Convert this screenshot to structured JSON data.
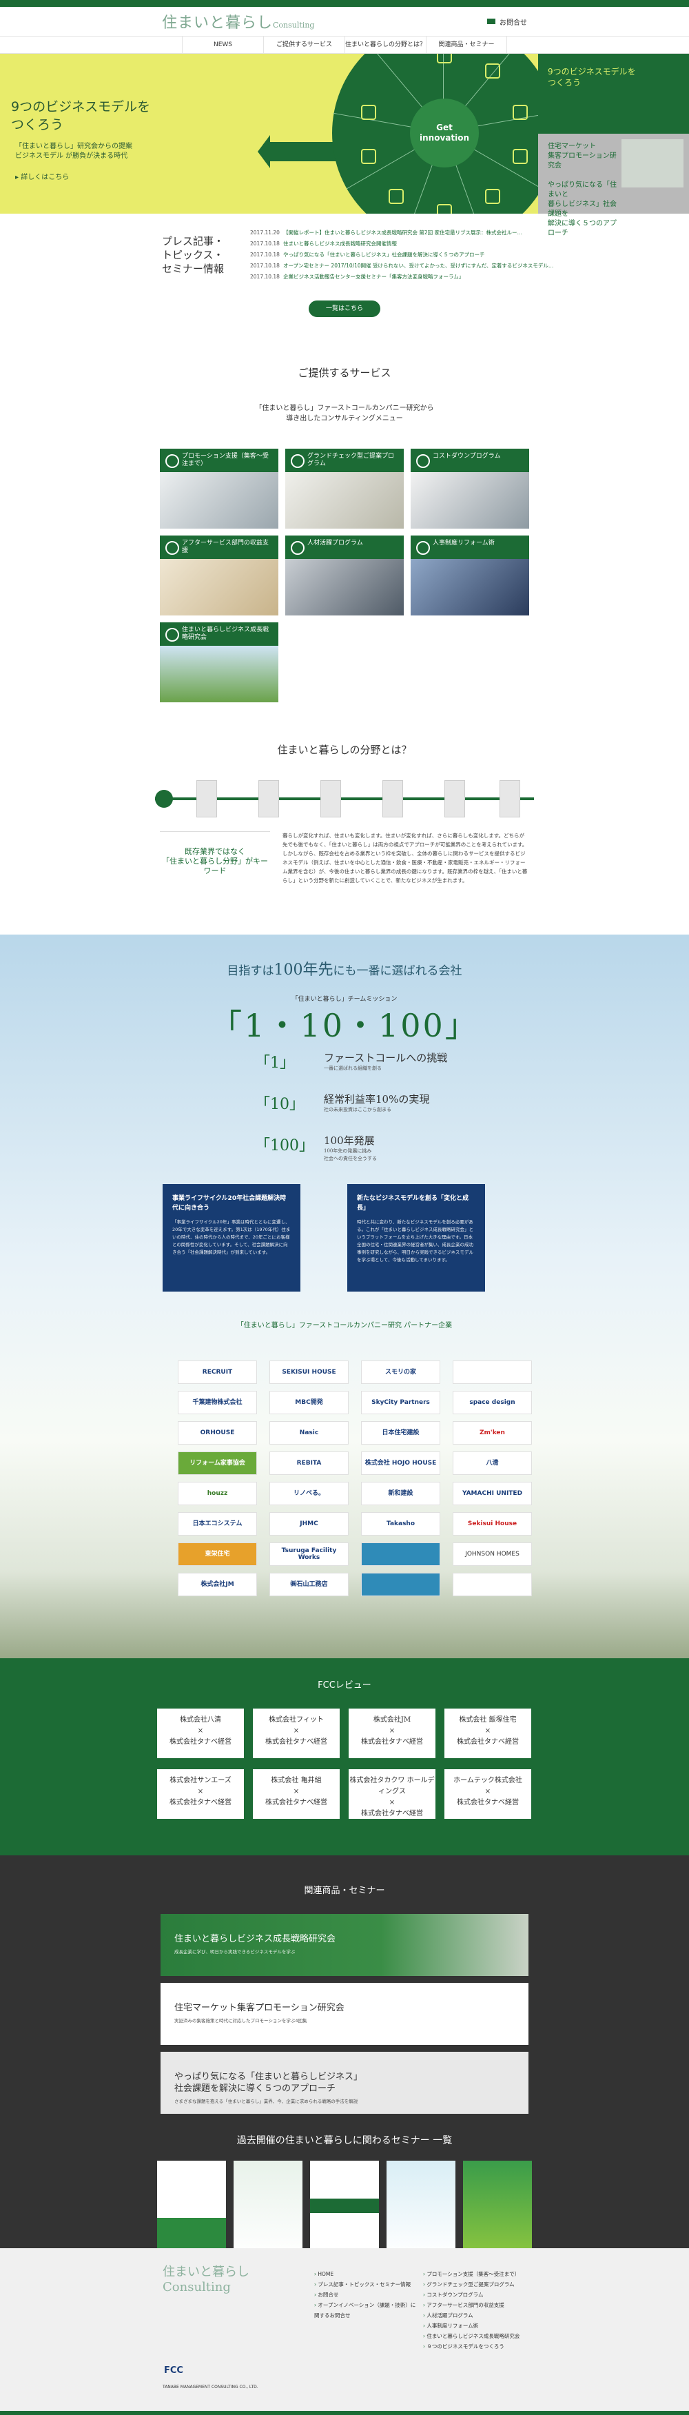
{
  "header": {
    "logo_main": "住まいと暮らし",
    "logo_sub": "Consulting",
    "contact": "お問合せ"
  },
  "nav": [
    "NEWS",
    "ご提供するサービス",
    "住まいと暮らしの分野とは？",
    "関連商品・セミナー"
  ],
  "hero": {
    "title_line1": "9つのビジネスモデルを",
    "title_line2": "つくろう",
    "sub_line1": "「住まいと暮らし」研究会からの提案",
    "sub_line2": "ビジネスモデル が勝負が決まる時代",
    "more": "詳しくはこちら",
    "center_line1": "Get",
    "center_line2": "innovation",
    "side1_line1": "9つのビジネスモデルを",
    "side1_line2": "つくろう",
    "side2_line1": "住宅マーケット",
    "side2_line2": "集客プロモーション研究会",
    "side2_line3": "やっぱり気になる「住まいと",
    "side2_line4": "暮らしビジネス」社会課題を",
    "side2_line5": "解決に導く５つのアプローチ"
  },
  "news": {
    "title_line1": "プレス記事・",
    "title_line2": "トピックス・",
    "title_line3": "セミナー情報",
    "items": [
      {
        "date": "2017.11.20",
        "text": "【開催レポート】住まいと暮らしビジネス成長戦略研究会 第2回 家住宅最リブス展示：株式会社ルー…"
      },
      {
        "date": "2017.10.18",
        "text": "住まいと暮らしビジネス成長戦略研究会開催情報"
      },
      {
        "date": "2017.10.18",
        "text": "やっぱり気になる「住まいと暮らしビジネス」社会課題を解決に導く５つのアプローチ"
      },
      {
        "date": "2017.10.18",
        "text": "オープン宅セミナー 2017/10/10開催 受けられない、受けてよかった、受けずにすんだ、定着するビジネスモデル…"
      },
      {
        "date": "2017.10.18",
        "text": "企業ビジネス活動報告センター支援セミナー「集客方法変身戦略フォーラム」"
      }
    ],
    "button": "一覧はこちら"
  },
  "services": {
    "title": "ご提供するサービス",
    "lead_line1": "「住まいと暮らし」ファーストコールカンパニー研究から",
    "lead_line2": "導き出したコンサルティングメニュー",
    "items": [
      {
        "label": "プロモーション支援（集客〜受注まで）"
      },
      {
        "label": "グランドチェック型ご提案プログラム"
      },
      {
        "label": "コストダウンプログラム"
      },
      {
        "label": "アフターサービス部門の収益支援"
      },
      {
        "label": "人材活躍プログラム"
      },
      {
        "label": "人事制度リフォーム術"
      },
      {
        "label": "住まいと暮らしビジネス成長戦略研究会"
      }
    ]
  },
  "field": {
    "title": "住まいと暮らしの分野とは？",
    "key_line1": "既存業界ではなく",
    "key_line2": "「住まいと暮らし分野」がキーワード",
    "body": "暮らしが変化すれば、住まいも変化します。住まいが変化すれば、さらに暮らしも変化します。どちらが先でも後でもなく、「住まいと暮らし」は両方の視点でアプローチが可能業界のことを考えられています。しかしながら、既存会社を占める業界という枠を突破し、全体の暮らしに関わるサービスを提供するビジネスモデル（例えば、住まいを中心とした通信・飲食・医療・不動産・家電販売・エネルギー・リフォーム業界を含む）が、今後の住まいと暮らし業界の成長の鍵になります。既存業界の枠を越え、「住まいと暮らし」という分野を新たに創造していくことで、新たなビジネスが生まれます。"
  },
  "mission": {
    "title_a": "目指すは",
    "title_b": "100年先",
    "title_c": "にも一番に選ばれる会社",
    "sub": "「住まいと暮らし」チームミッション",
    "number": "「1・10・100」",
    "rows": [
      {
        "key": "「1」",
        "value": "ファーストコールへの挑戦",
        "note": "一番に選ばれる組織を創る"
      },
      {
        "key": "「10」",
        "value": "経常利益率10%の実現",
        "note": "社の未来投資はここから創まる"
      },
      {
        "key": "「100」",
        "value": "100年発展",
        "note1": "100年先の発展に挑み",
        "note2": "社会への責任を全うする"
      }
    ],
    "box1_title": "事業ライフサイクル20年社会課題解決時代に向き合う",
    "box1_text": "「事業ライフサイクル20年」事業は時代とともに変遷し、20年で大きな変革を迎えます。第1次は（1970年代）住まいの時代、住の時代から人の時代まで、20年ごとにお客様との関係性が変化しています。そして、社会課題解決に向き合う「社会課題解決時代」が到来しています。",
    "box2_title": "新たなビジネスモデルを創る「変化と成長」",
    "box2_text": "時代と共に変わり、新たなビジネスモデルを創る必要がある。これが「住まいと暮らしビジネス成長戦略研究会」というプラットフォームを立ち上げた大きな理由です。日本全国の住宅・住関連業界の経営者が集い、成長企業の成功事例を研究しながら、明日から実践できるビジネスモデルを学ぶ場として、今後も活動してまいります。",
    "partner_title": "「住まいと暮らし」ファーストコールカンパニー研究 パートナー企業",
    "partners": [
      "RECRUIT",
      "SEKISUI HOUSE",
      "スモリの家",
      "",
      "千葉建物株式会社",
      "MBC開発",
      "SkyCity Partners",
      "space design",
      "ORHOUSE",
      "Nasic",
      "日本住宅建設",
      "Zm'ken",
      "リフォーム家事協会",
      "REBITA",
      "株式会社 HOJO HOUSE",
      "八清",
      "houzz",
      "リノベる。",
      "新和建設",
      "YAMACHI UNITED",
      "日本エコシステム",
      "JHMC",
      "Takasho",
      "Sekisui House",
      "東栄住宅",
      "Tsuruga Facility Works",
      "",
      "JOHNSON HOMES",
      "株式会社JM",
      "㈱石山工務店",
      "",
      ""
    ]
  },
  "fcc": {
    "title": "FCCレビュー",
    "cards": [
      {
        "a": "株式会社八清",
        "b": "×",
        "c": "株式会社タナベ経営"
      },
      {
        "a": "株式会社フィット",
        "b": "×",
        "c": "株式会社タナベ経営"
      },
      {
        "a": "株式会社JM",
        "b": "×",
        "c": "株式会社タナベ経営"
      },
      {
        "a": "株式会社 飯塚住宅",
        "b": "×",
        "c": "株式会社タナベ経営"
      },
      {
        "a": "株式会社サンエーズ",
        "b": "×",
        "c": "株式会社タナベ経営"
      },
      {
        "a": "株式会社 亀井組",
        "b": "×",
        "c": "株式会社タナベ経営"
      },
      {
        "a": "株式会社タカクワ ホールディングス",
        "b": "×",
        "c": "株式会社タナベ経営"
      },
      {
        "a": "ホームテック株式会社",
        "b": "×",
        "c": "株式会社タナベ経営"
      }
    ]
  },
  "related": {
    "title": "関連商品・セミナー",
    "b1_title": "住まいと暮らしビジネス成長戦略研究会",
    "b1_sub": "成長企業に学び、明日から実践できるビジネスモデルを学ぶ",
    "b2_title": "住宅マーケット集客プロモーション研究会",
    "b2_sub": "実証済みの集客施策と時代に対応したプロモーションを学ぶ4回集",
    "b3_title_line1": "やっぱり気になる「住まいと暮らしビジネス」",
    "b3_title_line2": "社会課題を解決に導く５つのアプローチ",
    "b3_sub": "さまざまな課題を抱える「住まいと暮らし」業界、今、企業に求められる戦略の手法を解説",
    "past_title": "過去開催の住まいと暮らしに関わるセミナー 一覧"
  },
  "footer": {
    "logo_main": "住まいと暮らし",
    "logo_sub": "Consulting",
    "col1": [
      "HOME",
      "プレス記事・トピックス・セミナー情報",
      "お問合せ",
      "オープンイノベーション（課題・技術）に関するお問合せ"
    ],
    "col2": [
      "プロモーション支援（集客〜受注まで）",
      "グランドチェック型ご提案プログラム",
      "コストダウンプログラム",
      "アフターサービス部門の収益支援",
      "人材活躍プログラム",
      "人事制度リフォーム術",
      "住まいと暮らしビジネス成長戦略研究会",
      "９つのビジネスモデルをつくろう"
    ],
    "fcc_mark": "FCC",
    "fcc_sub": "TANABE MANAGEMENT CONSULTING CO., LTD."
  }
}
